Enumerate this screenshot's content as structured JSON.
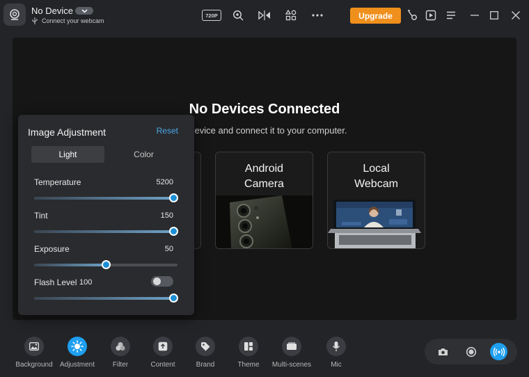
{
  "titlebar": {
    "device_name": "No Device",
    "device_subtitle": "Connect your webcam",
    "resolution_badge": "720P",
    "upgrade_label": "Upgrade"
  },
  "main": {
    "title": "No Devices Connected",
    "subtitle": "a device and connect it to your computer.",
    "cards": [
      {
        "title_line1": "Android",
        "title_line2": "Camera"
      },
      {
        "title_line1": "Local",
        "title_line2": "Webcam"
      }
    ]
  },
  "panel": {
    "title": "Image Adjustment",
    "reset_label": "Reset",
    "tabs": [
      {
        "label": "Light",
        "active": true
      },
      {
        "label": "Color",
        "active": false
      }
    ],
    "rows": [
      {
        "label": "Temperature",
        "value": "5200",
        "level": 0.97
      },
      {
        "label": "Tint",
        "value": "150",
        "level": 0.97
      },
      {
        "label": "Exposure",
        "value": "50",
        "level": 0.5
      },
      {
        "label": "Flash Level",
        "value": "100",
        "level": 0.97
      }
    ],
    "flash_toggle_on": false
  },
  "toolbar": {
    "items": [
      {
        "label": "Background",
        "icon": "image-icon"
      },
      {
        "label": "Adjustment",
        "icon": "sun-icon",
        "active": true
      },
      {
        "label": "Filter",
        "icon": "filter-icon"
      },
      {
        "label": "Content",
        "icon": "upload-icon"
      },
      {
        "label": "Brand",
        "icon": "tag-icon"
      },
      {
        "label": "Theme",
        "icon": "layout-icon"
      },
      {
        "label": "Multi-scenes",
        "icon": "scenes-icon"
      },
      {
        "label": "Mic",
        "icon": "mic-icon"
      }
    ]
  },
  "colors": {
    "accent": "#1e9ff0",
    "upgrade": "#f0901c",
    "link": "#4aa8e8"
  }
}
